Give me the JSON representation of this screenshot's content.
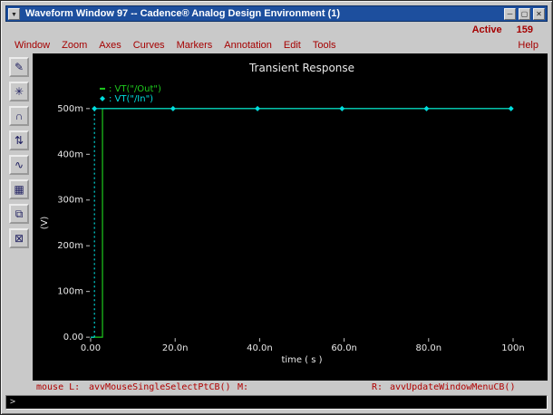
{
  "window": {
    "title": "Waveform Window 97 -- Cadence® Analog Design Environment (1)",
    "menu_button_glyph": "▼",
    "minimize_glyph": "─",
    "maximize_glyph": "▢",
    "close_glyph": "✕"
  },
  "active": {
    "label": "Active",
    "count": "159"
  },
  "menu": {
    "items": [
      "Window",
      "Zoom",
      "Axes",
      "Curves",
      "Markers",
      "Annotation",
      "Edit",
      "Tools"
    ],
    "help": "Help"
  },
  "toolbar": {
    "icons": [
      {
        "name": "pen",
        "glyph": "✎"
      },
      {
        "name": "zoom-fit",
        "glyph": "✳"
      },
      {
        "name": "pan",
        "glyph": "∩"
      },
      {
        "name": "vertical-markers",
        "glyph": "⇅"
      },
      {
        "name": "waveform",
        "glyph": "∿"
      },
      {
        "name": "grid",
        "glyph": "▦"
      },
      {
        "name": "copy-window",
        "glyph": "⧉"
      },
      {
        "name": "delete-window",
        "glyph": "⊠"
      }
    ]
  },
  "chart_data": {
    "type": "line",
    "title": "Transient Response",
    "xlabel": "time ( s )",
    "ylabel": "(V)",
    "x_unit": "ns",
    "xlim": [
      0,
      100
    ],
    "ylim": [
      0,
      0.5
    ],
    "x_ticks": [
      "0.00",
      "20.0n",
      "40.0n",
      "60.0n",
      "80.0n",
      "100n"
    ],
    "x_tick_values": [
      0,
      20,
      40,
      60,
      80,
      100
    ],
    "y_ticks": [
      "0.00",
      "100m",
      "200m",
      "300m",
      "400m",
      "500m"
    ],
    "y_tick_values": [
      0,
      0.1,
      0.2,
      0.3,
      0.4,
      0.5
    ],
    "text_color": "#e8e8e8",
    "grid": false,
    "legend_position": "top-left",
    "series": [
      {
        "name": "VT(\"/Out\")",
        "color": "#1ecb1e",
        "legend_marker": "dash",
        "segments": [
          {
            "points": [
              [
                0,
                0
              ],
              [
                2.8,
                0
              ],
              [
                2.8,
                0.5
              ],
              [
                100,
                0.5
              ]
            ]
          }
        ]
      },
      {
        "name": "VT(\"/In\")",
        "color": "#00dede",
        "legend_marker": "diamond",
        "segments": [
          {
            "points": [
              [
                0,
                0
              ],
              [
                0.9,
                0
              ]
            ]
          },
          {
            "points": [
              [
                0.9,
                0
              ],
              [
                0.9,
                0.5
              ]
            ],
            "dash": "2,3"
          },
          {
            "points": [
              [
                0.9,
                0.5
              ],
              [
                100,
                0.5
              ]
            ]
          }
        ],
        "markers": [
          [
            0.9,
            0.5
          ],
          [
            19.5,
            0.5
          ],
          [
            39.5,
            0.5
          ],
          [
            59.5,
            0.5
          ],
          [
            79.5,
            0.5
          ],
          [
            99.5,
            0.5
          ]
        ]
      }
    ]
  },
  "status": {
    "mouse_l_label": "mouse L:",
    "mouse_l_value": "avvMouseSingleSelectPtCB()",
    "m_label": "M:",
    "r_label": "R:",
    "r_value": "avvUpdateWindowMenuCB()",
    "prompt": ">"
  }
}
